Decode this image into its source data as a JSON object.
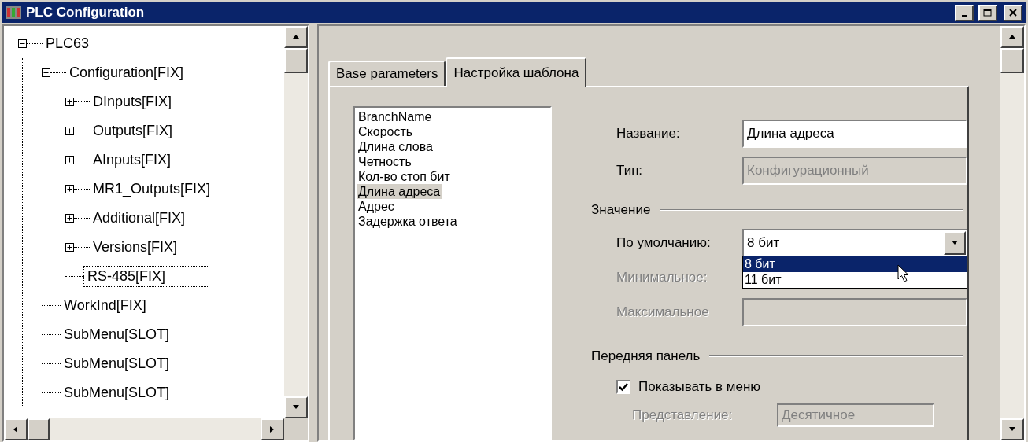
{
  "window": {
    "title": "PLC Configuration"
  },
  "tree": [
    {
      "label": "PLC63",
      "kind": "folder",
      "expanded": true,
      "selected": false,
      "children": [
        {
          "label": "Configuration[FIX]",
          "kind": "folder",
          "expanded": true,
          "selected": false,
          "children": [
            {
              "label": "DInputs[FIX]",
              "kind": "folder",
              "expanded": false,
              "selected": false
            },
            {
              "label": "Outputs[FIX]",
              "kind": "folder",
              "expanded": false,
              "selected": false
            },
            {
              "label": "AInputs[FIX]",
              "kind": "folder",
              "expanded": false,
              "selected": false
            },
            {
              "label": "MR1_Outputs[FIX]",
              "kind": "folder",
              "expanded": false,
              "selected": false
            },
            {
              "label": "Additional[FIX]",
              "kind": "folder",
              "expanded": false,
              "selected": false
            },
            {
              "label": "Versions[FIX]",
              "kind": "folder",
              "expanded": false,
              "selected": false
            },
            {
              "label": "RS-485[FIX]",
              "kind": "leaf",
              "selected": true
            }
          ]
        },
        {
          "label": "WorkInd[FIX]",
          "kind": "leaf",
          "selected": false
        },
        {
          "label": "SubMenu[SLOT]",
          "kind": "leaf",
          "selected": false
        },
        {
          "label": "SubMenu[SLOT]",
          "kind": "leaf",
          "selected": false
        },
        {
          "label": "SubMenu[SLOT]",
          "kind": "leaf",
          "selected": false
        }
      ]
    }
  ],
  "tabs": [
    {
      "label": "Base parameters",
      "selected": false
    },
    {
      "label": "Настройка шаблона",
      "selected": true
    }
  ],
  "parameters": [
    {
      "label": "BranchName",
      "selected": false
    },
    {
      "label": "Скорость",
      "selected": false
    },
    {
      "label": "Длина слова",
      "selected": false
    },
    {
      "label": "Четность",
      "selected": false
    },
    {
      "label": "Кол-во стоп бит",
      "selected": false
    },
    {
      "label": "Длина адреса",
      "selected": true
    },
    {
      "label": "Адрес",
      "selected": false
    },
    {
      "label": "Задержка ответа",
      "selected": false
    }
  ],
  "name_field": {
    "label": "Название:",
    "value": "Длина адреса"
  },
  "type_field": {
    "label": "Тип:",
    "value": "Конфигурационный",
    "disabled": true
  },
  "value_group": {
    "title": "Значение",
    "default": {
      "label": "По умолчанию:",
      "value": "8 бит",
      "expanded": true,
      "options": [
        {
          "label": "8 бит",
          "selected": true
        },
        {
          "label": "11 бит",
          "selected": false
        }
      ]
    },
    "minimum": {
      "label": "Минимальное:",
      "disabled": true
    },
    "maximum": {
      "label": "Максимальное",
      "disabled": true
    }
  },
  "front_panel_group": {
    "title": "Передняя панель",
    "show_in_menu": {
      "label": "Показывать в меню",
      "checked": true
    },
    "representation": {
      "label": "Представление:",
      "value": "Десятичное",
      "disabled": true
    }
  }
}
